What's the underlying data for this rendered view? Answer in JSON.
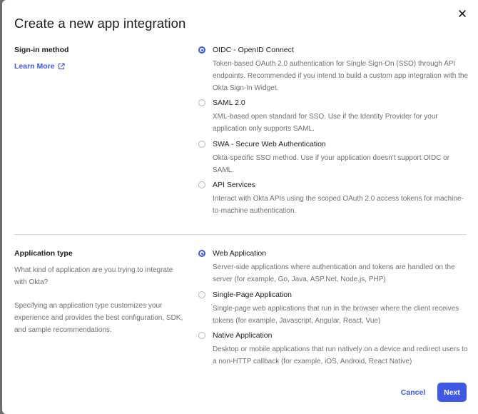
{
  "dialog": {
    "title": "Create a new app integration",
    "close_icon": "close-icon"
  },
  "sign_in": {
    "heading": "Sign-in method",
    "learn_more": "Learn More",
    "learn_more_icon": "external-link-icon",
    "selected": "oidc",
    "options": [
      {
        "id": "oidc",
        "label": "OIDC - OpenID Connect",
        "description": "Token-based OAuth 2.0 authentication for Single Sign-On (SSO) through API endpoints. Recommended if you intend to build a custom app integration with the Okta Sign-In Widget.",
        "checked": true
      },
      {
        "id": "saml",
        "label": "SAML 2.0",
        "description": "XML-based open standard for SSO. Use if the Identity Provider for your application only supports SAML.",
        "checked": false
      },
      {
        "id": "swa",
        "label": "SWA - Secure Web Authentication",
        "description": "Okta-specific SSO method. Use if your application doesn't support OIDC or SAML.",
        "checked": false
      },
      {
        "id": "api",
        "label": "API Services",
        "description": "Interact with Okta APIs using the scoped OAuth 2.0 access tokens for machine-to-machine authentication.",
        "checked": false
      }
    ]
  },
  "app_type": {
    "heading": "Application type",
    "question": "What kind of application are you trying to integrate with Okta?",
    "note": "Specifying an application type customizes your experience and provides the best configuration, SDK, and sample recommendations.",
    "selected": "web",
    "options": [
      {
        "id": "web",
        "label": "Web Application",
        "description": "Server-side applications where authentication and tokens are handled on the server (for example, Go, Java, ASP.Net, Node.js, PHP)",
        "checked": true
      },
      {
        "id": "spa",
        "label": "Single-Page Application",
        "description": "Single-page web applications that run in the browser where the client receives tokens (for example, Javascript, Angular, React, Vue)",
        "checked": false
      },
      {
        "id": "native",
        "label": "Native Application",
        "description": "Desktop or mobile applications that run natively on a device and redirect users to a non-HTTP callback (for example, iOS, Android, React Native)",
        "checked": false
      }
    ]
  },
  "footer": {
    "cancel_label": "Cancel",
    "next_label": "Next"
  },
  "colors": {
    "accent": "#3f59e4",
    "text": "#1d1d21",
    "muted": "#6e6e78",
    "divider": "#d7d7dc"
  }
}
